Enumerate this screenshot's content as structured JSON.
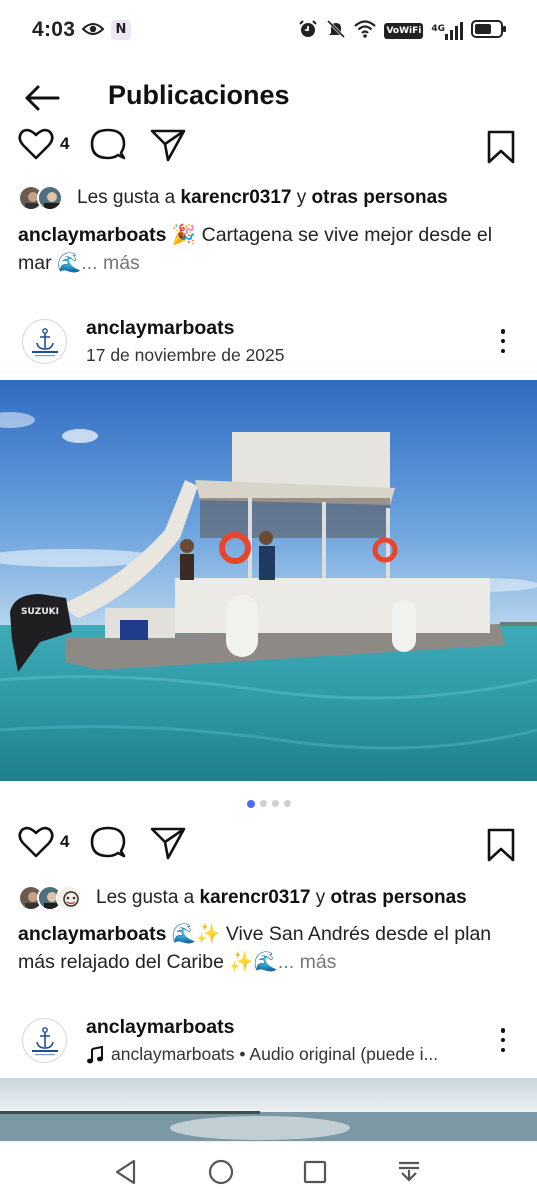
{
  "status_bar": {
    "time": "4:03",
    "notification_badge": "N",
    "vowifi_label": "VoWiFi",
    "network_label": "4G",
    "icons": [
      "eye-icon",
      "alarm-icon",
      "bell-muted-icon",
      "wifi-icon",
      "signal-icon",
      "battery-icon"
    ]
  },
  "header": {
    "title": "Publicaciones",
    "back_icon": "arrow-left-icon"
  },
  "post_prev": {
    "like_count": "4",
    "likes_prefix": "Les gusta a ",
    "liked_by_user": "karencr0317",
    "likes_connector": " y ",
    "likes_others": "otras personas",
    "caption_user": "anclaymarboats",
    "caption_text": "🎉 Cartagena se vive mejor desde el mar 🌊",
    "caption_more": "... más"
  },
  "post_main": {
    "username": "anclaymarboats",
    "date": "17 de noviembre de 2025",
    "carousel_total": 4,
    "carousel_active_index": 0,
    "boat_motor_brand": "SUZUKI",
    "like_count": "4",
    "likes_prefix": "Les gusta a ",
    "liked_by_user": "karencr0317",
    "likes_connector": " y ",
    "likes_others": "otras personas",
    "caption_user": "anclaymarboats",
    "caption_text": "🌊✨ Vive San Andrés desde el plan más relajado del Caribe ✨🌊",
    "caption_more": "... más"
  },
  "post_next": {
    "username": "anclaymarboats",
    "audio_text": "anclaymarboats • Audio original (puede i..."
  },
  "nav_bar": {
    "icons": [
      "back-triangle-icon",
      "home-circle-icon",
      "recents-square-icon",
      "notification-pull-icon"
    ]
  },
  "colors": {
    "carousel_active": "#4a6cf7",
    "sky": "#3f7fcf",
    "sea": "#3aa9b3"
  }
}
